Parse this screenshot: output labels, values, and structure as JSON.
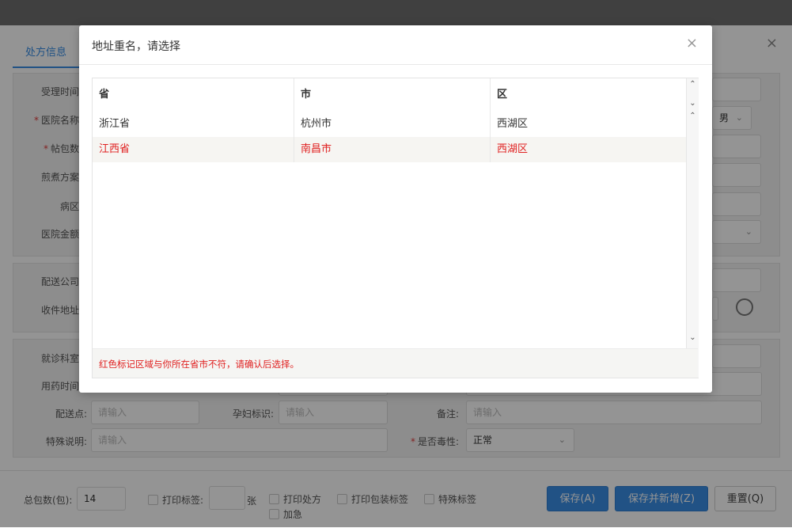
{
  "background": {
    "tab_active": "处方信息",
    "close_glyph": "×",
    "labels": {
      "accept_time": "受理时间",
      "hospital_name": "医院名称",
      "pack_count": "帖包数",
      "decoct_plan": "煎煮方案",
      "ward": "病区",
      "hospital_amount": "医院金额",
      "delivery_company": "配送公司",
      "recv_address": "收件地址",
      "department": "就诊科室",
      "med_time": "用药时间",
      "delivery_point": "配送点:",
      "pregnant_flag": "孕妇标识:",
      "remark": "备注:",
      "special_note": "特殊说明:",
      "toxic": "是否毒性:"
    },
    "required_mark": "*",
    "gender_value": "男",
    "placeholder": "请输入",
    "toxic_value": "正常"
  },
  "footer": {
    "total_packs_label": "总包数(包):",
    "total_packs_value": "14",
    "print_label": "打印标签:",
    "zhang": "张",
    "print_rx": "打印处方",
    "print_pack": "打印包装标签",
    "special_label": "特殊标签",
    "urgent": "加急",
    "save_btn": "保存(A)",
    "save_new_btn": "保存并新增(Z)",
    "reset_btn": "重置(Q)"
  },
  "dialog": {
    "title": "地址重名，请选择",
    "close_glyph": "×",
    "columns": [
      "省",
      "市",
      "区"
    ],
    "rows": [
      {
        "province": "浙江省",
        "city": "杭州市",
        "district": "西湖区",
        "highlight": false
      },
      {
        "province": "江西省",
        "city": "南昌市",
        "district": "西湖区",
        "highlight": true
      }
    ],
    "note": "红色标记区域与你所在省市不符，请确认后选择。",
    "colors": {
      "highlight": "#e02020",
      "accent": "#3a8ee6"
    }
  }
}
